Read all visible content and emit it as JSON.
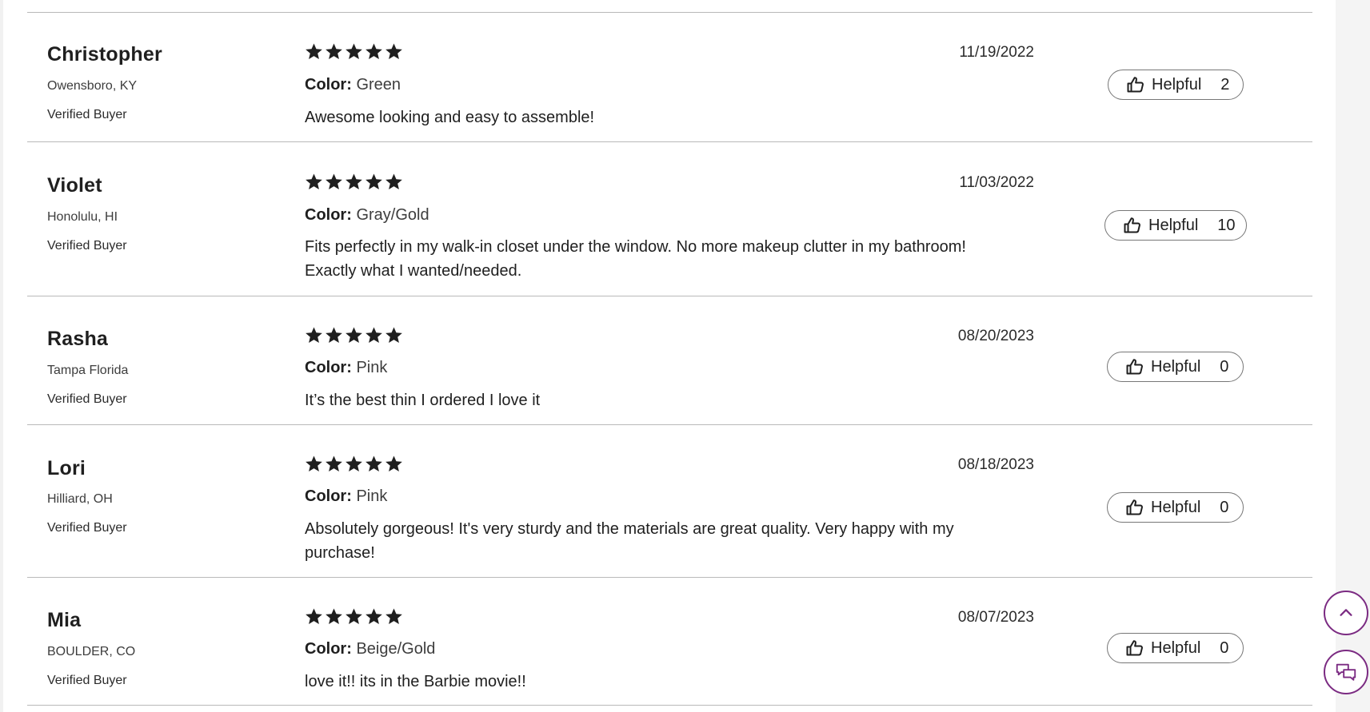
{
  "colors": {
    "accent": "#7b2b82",
    "text": "#1f1f1f",
    "divider": "#b9b9b9"
  },
  "reviews": [
    {
      "name": "Christopher",
      "location": "Owensboro, KY",
      "badge": "Verified Buyer",
      "rating": 5,
      "date": "11/19/2022",
      "color_label": "Color:",
      "color_value": "Green",
      "text": "Awesome looking and easy to assemble!",
      "helpful_label": "Helpful",
      "helpful_count": "2"
    },
    {
      "name": "Violet",
      "location": "Honolulu, HI",
      "badge": "Verified Buyer",
      "rating": 5,
      "date": "11/03/2022",
      "color_label": "Color:",
      "color_value": "Gray/Gold",
      "text": "Fits perfectly in my walk-in closet under the window. No more makeup clutter in my bathroom! Exactly what I wanted/needed.",
      "helpful_label": "Helpful",
      "helpful_count": "10"
    },
    {
      "name": "Rasha",
      "location": "Tampa Florida",
      "badge": "Verified Buyer",
      "rating": 5,
      "date": "08/20/2023",
      "color_label": "Color:",
      "color_value": "Pink",
      "text": "It’s the best thin I ordered I love it",
      "helpful_label": "Helpful",
      "helpful_count": "0"
    },
    {
      "name": "Lori",
      "location": "Hilliard, OH",
      "badge": "Verified Buyer",
      "rating": 5,
      "date": "08/18/2023",
      "color_label": "Color:",
      "color_value": "Pink",
      "text": "Absolutely gorgeous! It's very sturdy and the materials are great quality. Very happy with my purchase!",
      "helpful_label": "Helpful",
      "helpful_count": "0"
    },
    {
      "name": "Mia",
      "location": "BOULDER, CO",
      "badge": "Verified Buyer",
      "rating": 5,
      "date": "08/07/2023",
      "color_label": "Color:",
      "color_value": "Beige/Gold",
      "text": "love it!! its in the Barbie movie!!",
      "helpful_label": "Helpful",
      "helpful_count": "0"
    }
  ],
  "floating_buttons": {
    "scroll_top_icon": "chevron-up-icon",
    "chat_icon": "chat-bubbles-icon"
  }
}
